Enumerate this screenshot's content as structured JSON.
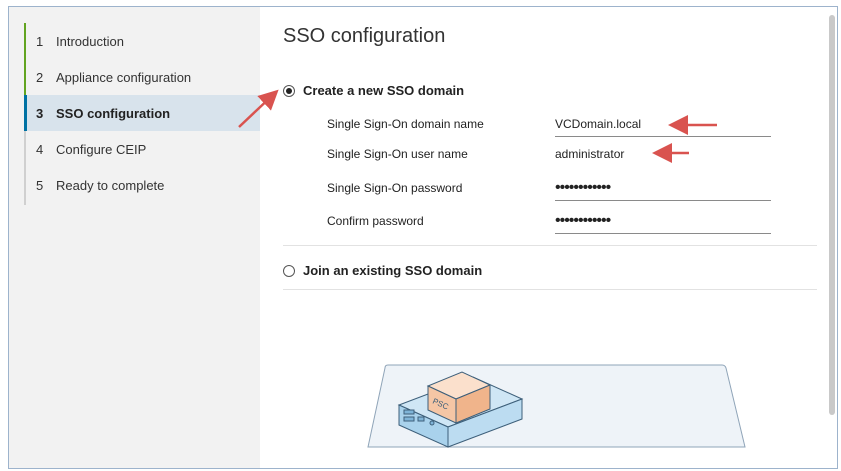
{
  "steps": [
    {
      "num": "1",
      "label": "Introduction"
    },
    {
      "num": "2",
      "label": "Appliance configuration"
    },
    {
      "num": "3",
      "label": "SSO configuration"
    },
    {
      "num": "4",
      "label": "Configure CEIP"
    },
    {
      "num": "5",
      "label": "Ready to complete"
    }
  ],
  "active_step": 3,
  "main": {
    "title": "SSO configuration",
    "create_option": "Create a new SSO domain",
    "join_option": "Join an existing SSO domain",
    "selected_option": "create"
  },
  "form": {
    "domain_label": "Single Sign-On domain name",
    "domain_value": "VCDomain.local",
    "user_label": "Single Sign-On user name",
    "user_value": "administrator",
    "password_label": "Single Sign-On password",
    "password_value": "••••••••••••",
    "confirm_label": "Confirm password",
    "confirm_value": "••••••••••••"
  },
  "illustration": {
    "badge": "PSC"
  },
  "colors": {
    "progress_done": "#62a420",
    "active_step_bg": "#d8e3ec",
    "annotation_arrow": "#d9534f",
    "psc_box": "#f5c6a5"
  },
  "icons": {
    "info": "info-icon",
    "arrow": "red-arrow-annotation"
  }
}
